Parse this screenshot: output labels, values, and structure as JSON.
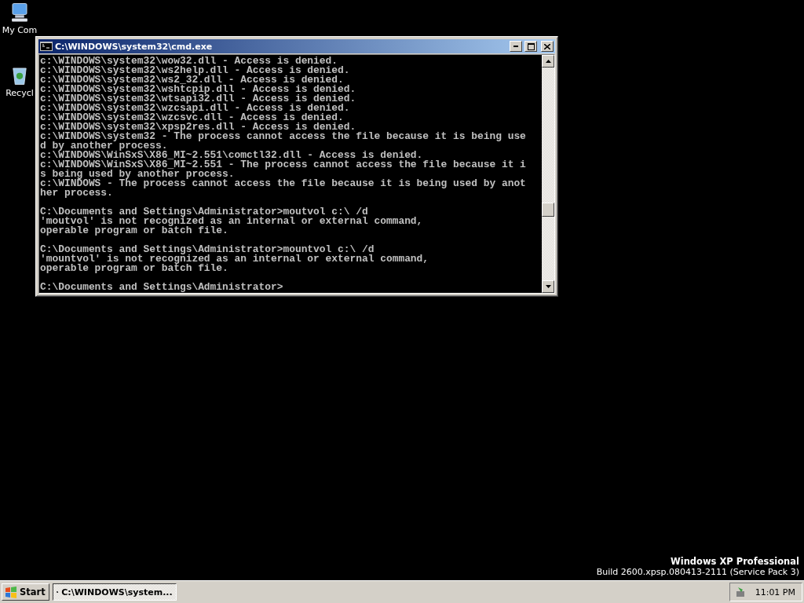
{
  "desktop_icons": [
    {
      "label": "My Com"
    },
    {
      "label": "Recycl"
    }
  ],
  "window": {
    "title": "C:\\WINDOWS\\system32\\cmd.exe",
    "console_blocks": [
      [
        "c:\\WINDOWS\\system32\\wow32.dll - Access is denied.",
        "c:\\WINDOWS\\system32\\ws2help.dll - Access is denied.",
        "c:\\WINDOWS\\system32\\ws2_32.dll - Access is denied.",
        "c:\\WINDOWS\\system32\\wshtcpip.dll - Access is denied.",
        "c:\\WINDOWS\\system32\\wtsapi32.dll - Access is denied.",
        "c:\\WINDOWS\\system32\\wzcsapi.dll - Access is denied.",
        "c:\\WINDOWS\\system32\\wzcsvc.dll - Access is denied.",
        "c:\\WINDOWS\\system32\\xpsp2res.dll - Access is denied.",
        "c:\\WINDOWS\\system32 - The process cannot access the file because it is being use",
        "d by another process.",
        "c:\\WINDOWS\\WinSxS\\X86_MI~2.551\\comctl32.dll - Access is denied.",
        "c:\\WINDOWS\\WinSxS\\X86_MI~2.551 - The process cannot access the file because it i",
        "s being used by another process.",
        "c:\\WINDOWS - The process cannot access the file because it is being used by anot",
        "her process."
      ],
      [
        "C:\\Documents and Settings\\Administrator>moutvol c:\\ /d",
        "'moutvol' is not recognized as an internal or external command,",
        "operable program or batch file."
      ],
      [
        "C:\\Documents and Settings\\Administrator>mountvol c:\\ /d",
        "'mountvol' is not recognized as an internal or external command,",
        "operable program or batch file."
      ],
      [
        "C:\\Documents and Settings\\Administrator>"
      ]
    ]
  },
  "os_banner": {
    "edition": "Windows XP Professional",
    "build": "Build 2600.xpsp.080413-2111 (Service Pack 3)"
  },
  "taskbar": {
    "start": "Start",
    "tasks": [
      {
        "label": "C:\\WINDOWS\\system...",
        "selected": true
      }
    ],
    "clock": "11:01 PM"
  }
}
